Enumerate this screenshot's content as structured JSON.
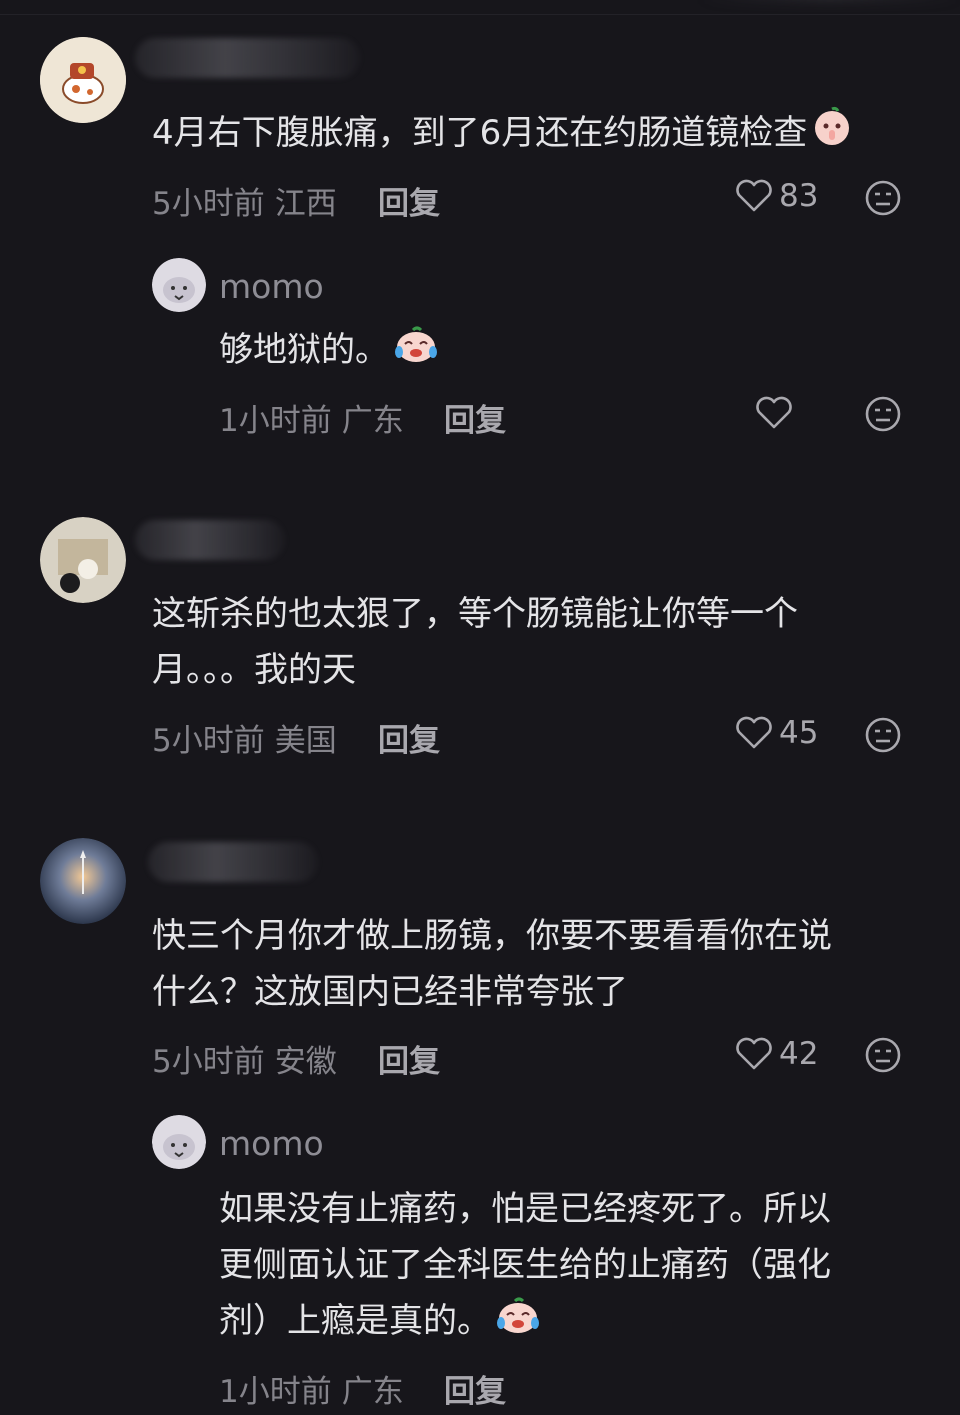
{
  "comments": [
    {
      "text_lines": [
        "4月右下腹胀痛，到了6月还在约肠道镜检查"
      ],
      "time": "5小时前",
      "location": "江西",
      "reply_label": "回复",
      "likes": "83",
      "reply": {
        "username": "momo",
        "text_lines": [
          "够地狱的。"
        ],
        "time": "1小时前",
        "location": "广东",
        "reply_label": "回复"
      }
    },
    {
      "text_lines": [
        "这斩杀的也太狠了，等个肠镜能让你等一个",
        "月。。。我的天"
      ],
      "time": "5小时前",
      "location": "美国",
      "reply_label": "回复",
      "likes": "45"
    },
    {
      "text_lines": [
        "快三个月你才做上肠镜，你要不要看看你在说",
        "什么？这放国内已经非常夸张了"
      ],
      "time": "5小时前",
      "location": "安徽",
      "reply_label": "回复",
      "likes": "42",
      "reply": {
        "username": "momo",
        "text_lines": [
          "如果没有止痛药，怕是已经疼死了。所以",
          "更侧面认证了全科医生给的止痛药（强化",
          "剂）上瘾是真的。"
        ],
        "time": "1小时前",
        "location": "广东",
        "reply_label": "回复"
      }
    }
  ],
  "icons": {
    "like": "heart-outline-icon",
    "dislike": "meh-face-icon",
    "emoji1": "shush-peach-emoji",
    "emoji2": "crying-laugh-peach-emoji"
  },
  "colors": {
    "background": "#17161b",
    "text": "#e4e4e7",
    "meta": "#85848b"
  }
}
